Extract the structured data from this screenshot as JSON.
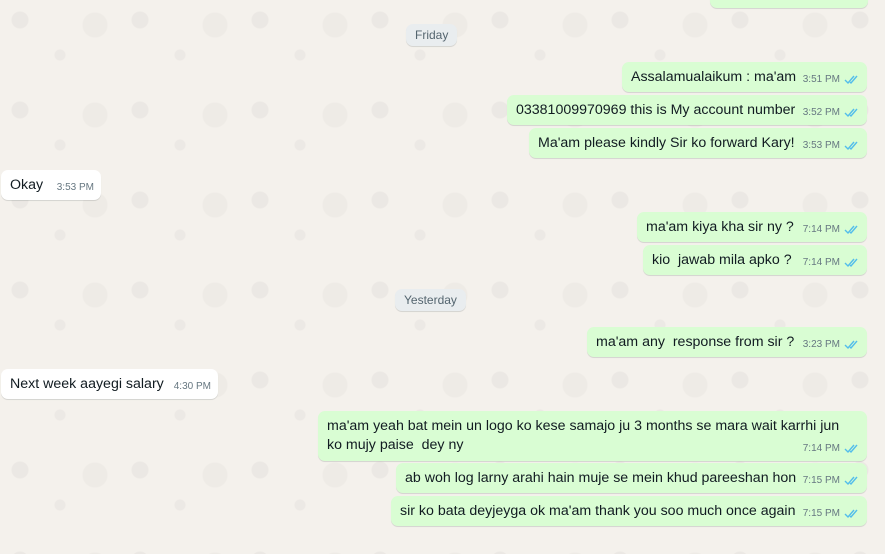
{
  "date_separators": {
    "friday": "Friday",
    "yesterday": "Yesterday"
  },
  "messages": [
    {
      "direction": "out",
      "text": "Assalamualaikum : ma'am",
      "time": "3:51 PM",
      "status": "read"
    },
    {
      "direction": "out",
      "text": "03381009970969 this is My account number",
      "time": "3:52 PM",
      "status": "read"
    },
    {
      "direction": "out",
      "text": "Ma'am please kindly Sir ko forward Kary!",
      "time": "3:53 PM",
      "status": "read"
    },
    {
      "direction": "in",
      "text": "Okay",
      "time": "3:53 PM"
    },
    {
      "direction": "out",
      "text": "ma'am kiya kha sir ny ?",
      "time": "7:14 PM",
      "status": "read"
    },
    {
      "direction": "out",
      "text": "kio  jawab mila apko ?",
      "time": "7:14 PM",
      "status": "read"
    },
    {
      "direction": "out",
      "text": "ma'am any  response from sir ?",
      "time": "3:23 PM",
      "status": "read"
    },
    {
      "direction": "in",
      "text": "Next week aayegi salary",
      "time": "4:30 PM"
    },
    {
      "direction": "out",
      "text": "ma'am yeah bat mein un logo ko kese samajo ju 3 months se mara wait karrhi jun ko mujy paise  dey ny",
      "time": "7:14 PM",
      "status": "read"
    },
    {
      "direction": "out",
      "text": "ab woh log larny arahi hain muje se mein khud pareeshan hon",
      "time": "7:15 PM",
      "status": "read"
    },
    {
      "direction": "out",
      "text": "sir ko bata deyjeyga ok ma'am thank you soo much once again",
      "time": "7:15 PM",
      "status": "read"
    }
  ],
  "colors": {
    "outgoing_bubble": "#d9fdd3",
    "incoming_bubble": "#ffffff",
    "read_ticks": "#53bdeb",
    "timestamp": "#667781"
  }
}
